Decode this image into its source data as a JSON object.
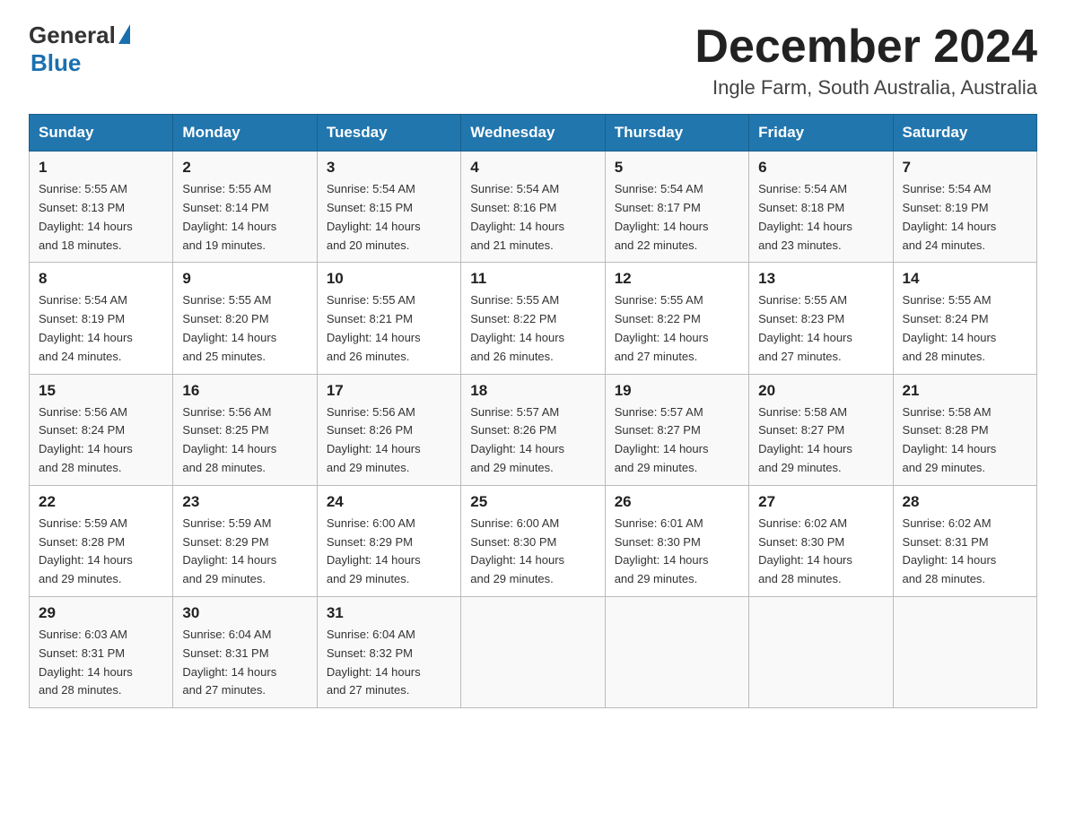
{
  "logo": {
    "general": "General",
    "blue": "Blue"
  },
  "header": {
    "month": "December 2024",
    "location": "Ingle Farm, South Australia, Australia"
  },
  "weekdays": [
    "Sunday",
    "Monday",
    "Tuesday",
    "Wednesday",
    "Thursday",
    "Friday",
    "Saturday"
  ],
  "weeks": [
    [
      {
        "day": "1",
        "sunrise": "5:55 AM",
        "sunset": "8:13 PM",
        "daylight": "14 hours and 18 minutes."
      },
      {
        "day": "2",
        "sunrise": "5:55 AM",
        "sunset": "8:14 PM",
        "daylight": "14 hours and 19 minutes."
      },
      {
        "day": "3",
        "sunrise": "5:54 AM",
        "sunset": "8:15 PM",
        "daylight": "14 hours and 20 minutes."
      },
      {
        "day": "4",
        "sunrise": "5:54 AM",
        "sunset": "8:16 PM",
        "daylight": "14 hours and 21 minutes."
      },
      {
        "day": "5",
        "sunrise": "5:54 AM",
        "sunset": "8:17 PM",
        "daylight": "14 hours and 22 minutes."
      },
      {
        "day": "6",
        "sunrise": "5:54 AM",
        "sunset": "8:18 PM",
        "daylight": "14 hours and 23 minutes."
      },
      {
        "day": "7",
        "sunrise": "5:54 AM",
        "sunset": "8:19 PM",
        "daylight": "14 hours and 24 minutes."
      }
    ],
    [
      {
        "day": "8",
        "sunrise": "5:54 AM",
        "sunset": "8:19 PM",
        "daylight": "14 hours and 24 minutes."
      },
      {
        "day": "9",
        "sunrise": "5:55 AM",
        "sunset": "8:20 PM",
        "daylight": "14 hours and 25 minutes."
      },
      {
        "day": "10",
        "sunrise": "5:55 AM",
        "sunset": "8:21 PM",
        "daylight": "14 hours and 26 minutes."
      },
      {
        "day": "11",
        "sunrise": "5:55 AM",
        "sunset": "8:22 PM",
        "daylight": "14 hours and 26 minutes."
      },
      {
        "day": "12",
        "sunrise": "5:55 AM",
        "sunset": "8:22 PM",
        "daylight": "14 hours and 27 minutes."
      },
      {
        "day": "13",
        "sunrise": "5:55 AM",
        "sunset": "8:23 PM",
        "daylight": "14 hours and 27 minutes."
      },
      {
        "day": "14",
        "sunrise": "5:55 AM",
        "sunset": "8:24 PM",
        "daylight": "14 hours and 28 minutes."
      }
    ],
    [
      {
        "day": "15",
        "sunrise": "5:56 AM",
        "sunset": "8:24 PM",
        "daylight": "14 hours and 28 minutes."
      },
      {
        "day": "16",
        "sunrise": "5:56 AM",
        "sunset": "8:25 PM",
        "daylight": "14 hours and 28 minutes."
      },
      {
        "day": "17",
        "sunrise": "5:56 AM",
        "sunset": "8:26 PM",
        "daylight": "14 hours and 29 minutes."
      },
      {
        "day": "18",
        "sunrise": "5:57 AM",
        "sunset": "8:26 PM",
        "daylight": "14 hours and 29 minutes."
      },
      {
        "day": "19",
        "sunrise": "5:57 AM",
        "sunset": "8:27 PM",
        "daylight": "14 hours and 29 minutes."
      },
      {
        "day": "20",
        "sunrise": "5:58 AM",
        "sunset": "8:27 PM",
        "daylight": "14 hours and 29 minutes."
      },
      {
        "day": "21",
        "sunrise": "5:58 AM",
        "sunset": "8:28 PM",
        "daylight": "14 hours and 29 minutes."
      }
    ],
    [
      {
        "day": "22",
        "sunrise": "5:59 AM",
        "sunset": "8:28 PM",
        "daylight": "14 hours and 29 minutes."
      },
      {
        "day": "23",
        "sunrise": "5:59 AM",
        "sunset": "8:29 PM",
        "daylight": "14 hours and 29 minutes."
      },
      {
        "day": "24",
        "sunrise": "6:00 AM",
        "sunset": "8:29 PM",
        "daylight": "14 hours and 29 minutes."
      },
      {
        "day": "25",
        "sunrise": "6:00 AM",
        "sunset": "8:30 PM",
        "daylight": "14 hours and 29 minutes."
      },
      {
        "day": "26",
        "sunrise": "6:01 AM",
        "sunset": "8:30 PM",
        "daylight": "14 hours and 29 minutes."
      },
      {
        "day": "27",
        "sunrise": "6:02 AM",
        "sunset": "8:30 PM",
        "daylight": "14 hours and 28 minutes."
      },
      {
        "day": "28",
        "sunrise": "6:02 AM",
        "sunset": "8:31 PM",
        "daylight": "14 hours and 28 minutes."
      }
    ],
    [
      {
        "day": "29",
        "sunrise": "6:03 AM",
        "sunset": "8:31 PM",
        "daylight": "14 hours and 28 minutes."
      },
      {
        "day": "30",
        "sunrise": "6:04 AM",
        "sunset": "8:31 PM",
        "daylight": "14 hours and 27 minutes."
      },
      {
        "day": "31",
        "sunrise": "6:04 AM",
        "sunset": "8:32 PM",
        "daylight": "14 hours and 27 minutes."
      },
      null,
      null,
      null,
      null
    ]
  ],
  "labels": {
    "sunrise": "Sunrise: ",
    "sunset": "Sunset: ",
    "daylight": "Daylight: "
  }
}
